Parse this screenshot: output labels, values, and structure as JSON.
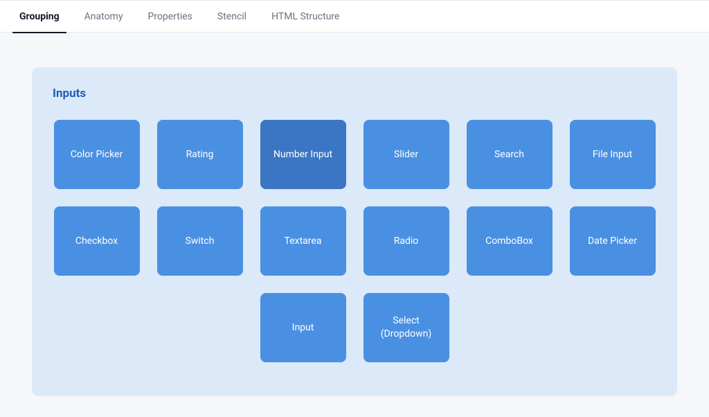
{
  "tabs": [
    {
      "label": "Grouping",
      "active": true
    },
    {
      "label": "Anatomy",
      "active": false
    },
    {
      "label": "Properties",
      "active": false
    },
    {
      "label": "Stencil",
      "active": false
    },
    {
      "label": "HTML Structure",
      "active": false
    }
  ],
  "panel": {
    "title": "Inputs",
    "tiles": [
      {
        "label": "Color Picker",
        "active": false
      },
      {
        "label": "Rating",
        "active": false
      },
      {
        "label": "Number Input",
        "active": true
      },
      {
        "label": "Slider",
        "active": false
      },
      {
        "label": "Search",
        "active": false
      },
      {
        "label": "File Input",
        "active": false
      },
      {
        "label": "Checkbox",
        "active": false
      },
      {
        "label": "Switch",
        "active": false
      },
      {
        "label": "Textarea",
        "active": false
      },
      {
        "label": "Radio",
        "active": false
      },
      {
        "label": "ComboBox",
        "active": false
      },
      {
        "label": "Date Picker",
        "active": false
      },
      {
        "label": "Input",
        "active": false
      },
      {
        "label": "Select (Dropdown)",
        "active": false
      }
    ]
  },
  "colors": {
    "tile": "#4a90e2",
    "tile_active": "#3a76c4",
    "panel_bg": "#dce9f9",
    "title": "#1e5fb3"
  }
}
